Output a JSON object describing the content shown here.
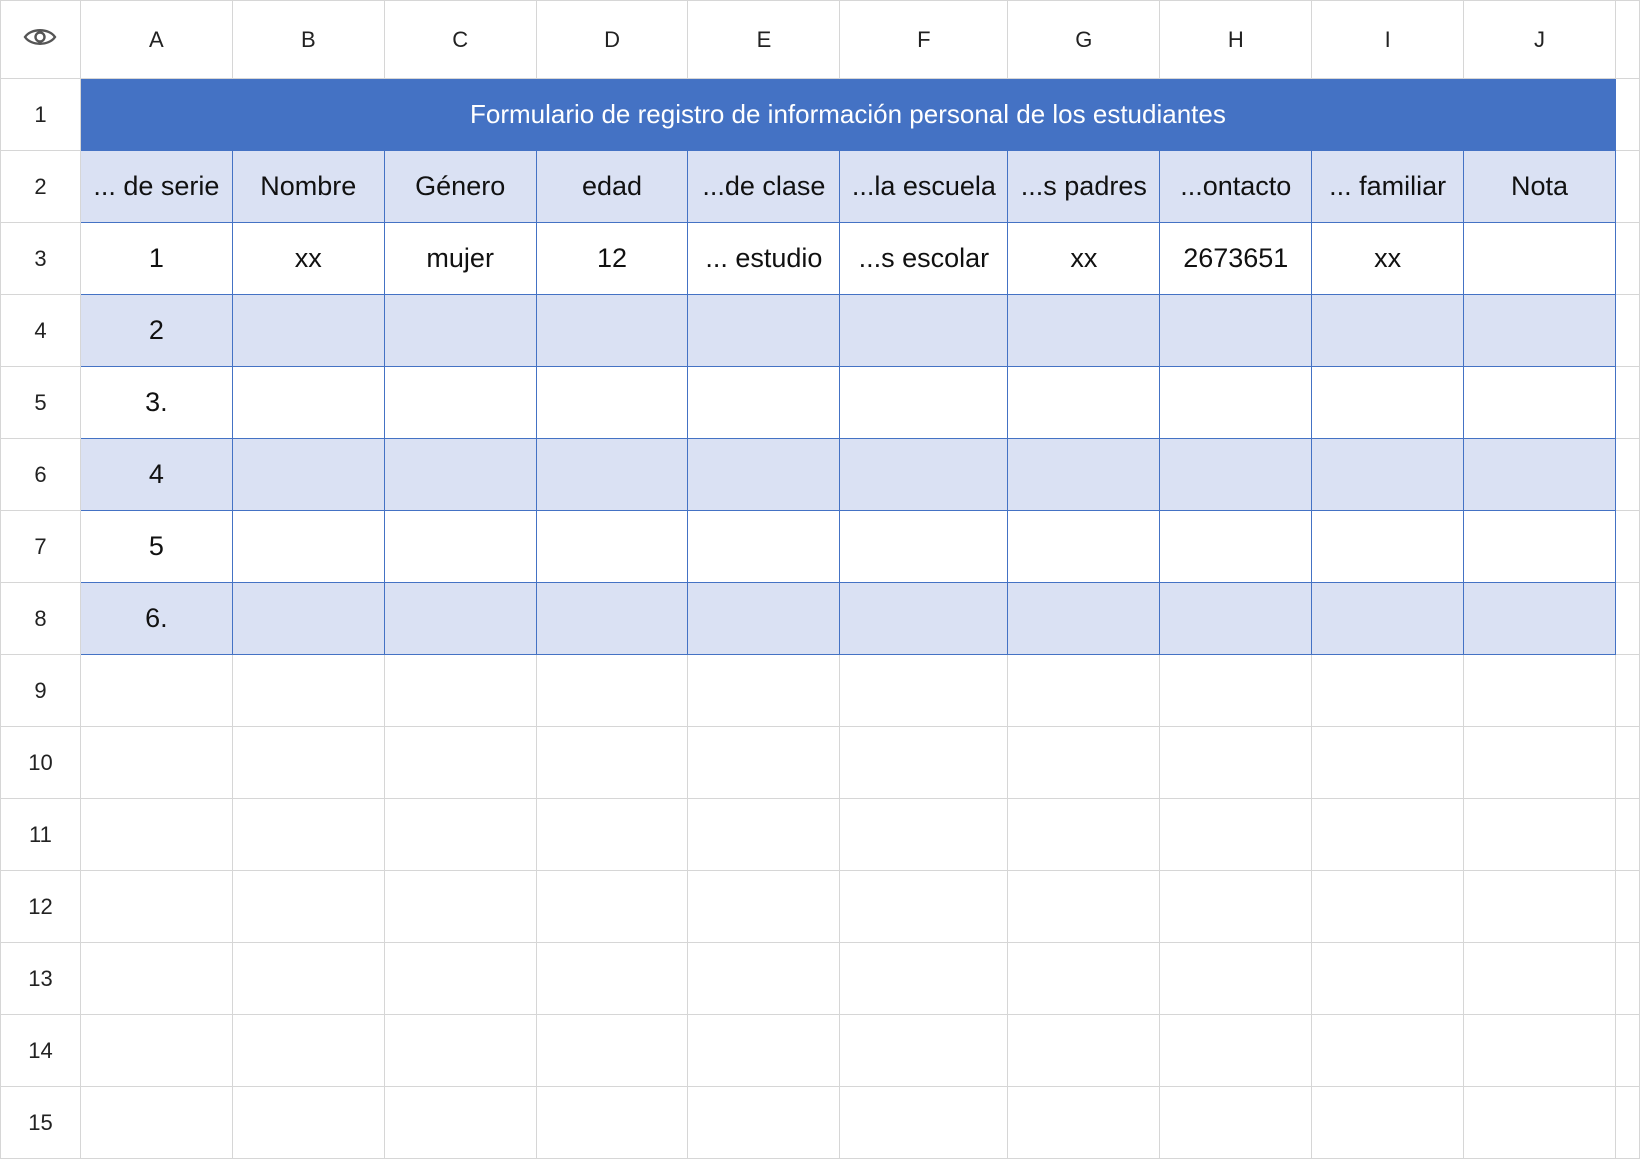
{
  "columns": [
    "A",
    "B",
    "C",
    "D",
    "E",
    "F",
    "G",
    "H",
    "I",
    "J"
  ],
  "rows": [
    "1",
    "2",
    "3",
    "4",
    "5",
    "6",
    "7",
    "8",
    "9",
    "10",
    "11",
    "12",
    "13",
    "14",
    "15"
  ],
  "title": "Formulario de registro de información personal de los estudiantes",
  "headers": [
    "... de serie",
    "Nombre",
    "Género",
    "edad",
    "...de clase",
    "...la escuela",
    "...s padres",
    "...ontacto",
    "... familiar",
    "Nota"
  ],
  "data_rows": [
    [
      "1",
      "xx",
      "mujer",
      "12",
      "... estudio",
      "...s escolar",
      "xx",
      "2673651",
      "xx",
      ""
    ],
    [
      "2",
      "",
      "",
      "",
      "",
      "",
      "",
      "",
      "",
      ""
    ],
    [
      "3.",
      "",
      "",
      "",
      "",
      "",
      "",
      "",
      "",
      ""
    ],
    [
      "4",
      "",
      "",
      "",
      "",
      "",
      "",
      "",
      "",
      ""
    ],
    [
      "5",
      "",
      "",
      "",
      "",
      "",
      "",
      "",
      "",
      ""
    ],
    [
      "6.",
      "",
      "",
      "",
      "",
      "",
      "",
      "",
      "",
      ""
    ]
  ],
  "colors": {
    "title_bg": "#4472c4",
    "band_bg": "#dae1f3",
    "border": "#4472c4"
  },
  "icons": {
    "corner": "eye-icon"
  }
}
